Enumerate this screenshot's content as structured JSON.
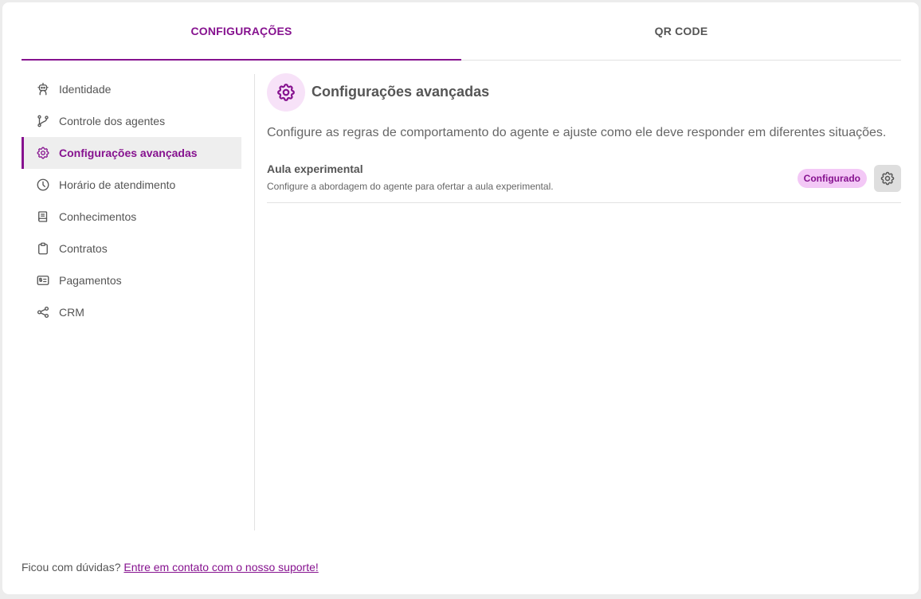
{
  "tabs": [
    {
      "label": "CONFIGURAÇÕES",
      "active": true
    },
    {
      "label": "QR CODE",
      "active": false
    }
  ],
  "sidebar": {
    "items": [
      {
        "label": "Identidade",
        "icon": "robot-icon"
      },
      {
        "label": "Controle dos agentes",
        "icon": "git-branch-icon"
      },
      {
        "label": "Configurações avançadas",
        "icon": "gear-icon",
        "active": true
      },
      {
        "label": "Horário de atendimento",
        "icon": "clock-icon"
      },
      {
        "label": "Conhecimentos",
        "icon": "book-icon"
      },
      {
        "label": "Contratos",
        "icon": "clipboard-icon"
      },
      {
        "label": "Pagamentos",
        "icon": "bill-icon"
      },
      {
        "label": "CRM",
        "icon": "share-icon"
      }
    ]
  },
  "main": {
    "title": "Configurações avançadas",
    "description": "Configure as regras de comportamento do agente e ajuste como ele deve responder em diferentes situações.",
    "settings": [
      {
        "title": "Aula experimental",
        "description": "Configure a abordagem do agente para ofertar a aula experimental.",
        "status": "Configurado"
      }
    ]
  },
  "footer": {
    "question": "Ficou com dúvidas?",
    "link_label": "Entre em contato com o nosso suporte!"
  },
  "colors": {
    "accent": "#86128f",
    "badge_bg": "#f3c8f6",
    "icon_circle_bg": "#f7e2f8"
  }
}
